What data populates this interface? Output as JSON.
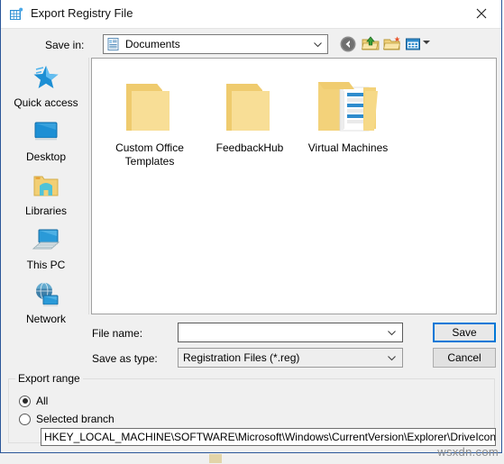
{
  "window": {
    "title": "Export Registry File",
    "icon": "registry-editor-icon",
    "close_label": "✕"
  },
  "savein": {
    "label": "Save in:",
    "value": "Documents",
    "icon": "documents-folder-icon"
  },
  "toolbar": {
    "buttons": [
      {
        "name": "back-button",
        "icon": "back-arrow-icon",
        "tooltip": "Back"
      },
      {
        "name": "up-button",
        "icon": "up-folder-icon",
        "tooltip": "Up one level"
      },
      {
        "name": "new-folder-button",
        "icon": "new-folder-icon",
        "tooltip": "Create New Folder"
      },
      {
        "name": "views-button",
        "icon": "views-icon",
        "tooltip": "Views"
      }
    ]
  },
  "places": [
    {
      "label": "Quick access",
      "icon": "quick-access-star-icon"
    },
    {
      "label": "Desktop",
      "icon": "desktop-monitor-icon"
    },
    {
      "label": "Libraries",
      "icon": "libraries-folder-icon"
    },
    {
      "label": "This PC",
      "icon": "this-pc-computer-icon"
    },
    {
      "label": "Network",
      "icon": "network-globe-icon"
    }
  ],
  "files": [
    {
      "label": "Custom Office Templates",
      "icon": "folder-icon"
    },
    {
      "label": "FeedbackHub",
      "icon": "folder-icon"
    },
    {
      "label": "Virtual Machines",
      "icon": "folder-with-files-icon"
    }
  ],
  "form": {
    "filename_label": "File name:",
    "filename_value": "",
    "filename_placeholder": "",
    "filetype_label": "Save as type:",
    "filetype_value": "Registration Files (*.reg)",
    "save_label": "Save",
    "cancel_label": "Cancel"
  },
  "export_range": {
    "legend": "Export range",
    "option_all": "All",
    "option_selected_branch": "Selected branch",
    "selected": "All",
    "branch_path": "HKEY_LOCAL_MACHINE\\SOFTWARE\\Microsoft\\Windows\\CurrentVersion\\Explorer\\DriveIcons\\C\\D"
  },
  "watermark": "wsxdn.com",
  "colors": {
    "accent": "#0078d7",
    "window_border": "#2a5699",
    "dialog_bg": "#f0f0f0",
    "folder_yellow": "#f7d882"
  }
}
